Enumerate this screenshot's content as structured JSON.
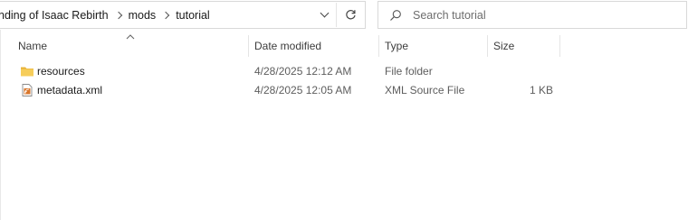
{
  "address_bar": {
    "breadcrumbs": [
      "nding of Isaac Rebirth",
      "mods",
      "tutorial"
    ],
    "dropdown_icon": "chevron-down-icon",
    "refresh_icon": "refresh-icon"
  },
  "search": {
    "placeholder": "Search tutorial",
    "icon": "search-icon"
  },
  "columns": {
    "name": "Name",
    "date_modified": "Date modified",
    "type": "Type",
    "size": "Size",
    "sorted_by": "name",
    "sort_direction": "ascending"
  },
  "files": [
    {
      "name": "resources",
      "date_modified": "4/28/2025 12:12 AM",
      "type": "File folder",
      "size": "",
      "icon": "folder-icon"
    },
    {
      "name": "metadata.xml",
      "date_modified": "4/28/2025 12:05 AM",
      "type": "XML Source File",
      "size": "1 KB",
      "icon": "xml-file-icon"
    }
  ],
  "colors": {
    "folder": "#f3c44b",
    "xml_icon": "#c8611d",
    "border": "#d9d9d9"
  }
}
